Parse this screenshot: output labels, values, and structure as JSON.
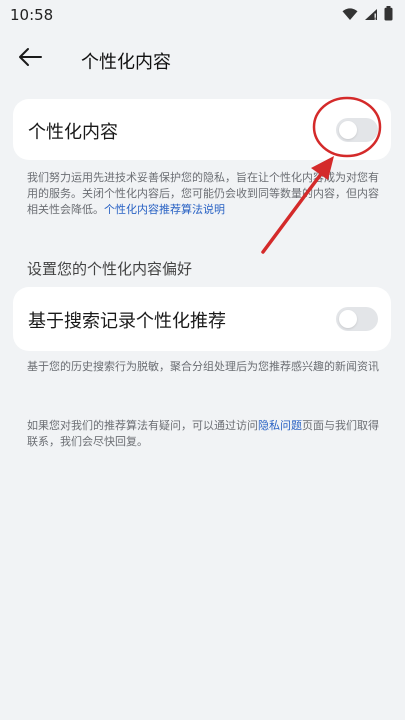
{
  "status_bar": {
    "time": "10:58",
    "icons": [
      "wifi-icon",
      "signal-icon",
      "battery-icon"
    ]
  },
  "header": {
    "back_icon": "arrow-left-icon",
    "title": "个性化内容"
  },
  "personalized_card": {
    "label": "个性化内容",
    "toggle_on": false
  },
  "personalized_desc": {
    "text": "我们努力运用先进技术妥善保护您的隐私，旨在让个性化内容成为对您有用的服务。关闭个性化内容后，您可能仍会收到同等数量的内容，但内容相关性会降低。",
    "link": "个性化内容推荐算法说明"
  },
  "preferences_section": {
    "title": "设置您的个性化内容偏好"
  },
  "search_card": {
    "label": "基于搜索记录个性化推荐",
    "toggle_on": false
  },
  "search_desc": {
    "text": "基于您的历史搜索行为脱敏，聚合分组处理后为您推荐感兴趣的新闻资讯"
  },
  "contact_desc": {
    "prefix": "如果您对我们的推荐算法有疑问，可以通过访问",
    "link": "隐私问题",
    "suffix": "页面与我们取得联系，我们会尽快回复。"
  },
  "colors": {
    "background": "#f1f3f5",
    "card": "#ffffff",
    "link": "#2962c4",
    "toggle_off": "#e3e5e8",
    "annotation_red": "#d42a2a"
  }
}
